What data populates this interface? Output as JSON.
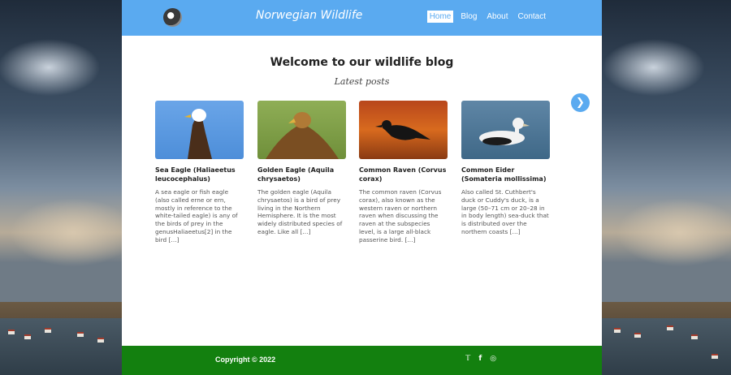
{
  "header": {
    "site_title": "Norwegian Wildlife",
    "logo_icon": "wildlife-logo-icon",
    "nav": [
      "Home",
      "Blog",
      "About",
      "Contact"
    ],
    "active_nav": "Home"
  },
  "main": {
    "heading": "Welcome to our wildlife blog",
    "subheading": "Latest posts",
    "next_icon": "chevron-right-icon",
    "posts": [
      {
        "title": "Sea Eagle (Haliaeetus leucocephalus)",
        "excerpt": "A sea eagle or fish eagle (also called erne or ern, mostly in reference to the white-tailed eagle) is any of the birds of prey in the genusHaliaeetus[2] in the bird […]"
      },
      {
        "title": "Golden Eagle (Aquila chrysaetos)",
        "excerpt": "The golden eagle (Aquila chrysaetos) is a bird of prey living in the Northern Hemisphere. It is the most widely distributed species of eagle. Like all […]"
      },
      {
        "title": "Common Raven (Corvus corax)",
        "excerpt": "The common raven (Corvus corax), also known as the western raven or northern raven when discussing the raven at the subspecies level, is a large all-black passerine bird. […]"
      },
      {
        "title": "Common Eider (Somateria mollissima)",
        "excerpt": "Also called St. Cuthbert's duck or Cuddy's duck, is a large (50–71 cm or 20–28 in in body length) sea-duck that is distributed over the northern coasts […]"
      }
    ]
  },
  "footer": {
    "copyright": "Copyright © 2022",
    "social_icons": [
      "twitter-icon",
      "facebook-icon",
      "instagram-icon"
    ],
    "colors": {
      "header": "#5aaaf0",
      "footer": "#13800f"
    }
  }
}
